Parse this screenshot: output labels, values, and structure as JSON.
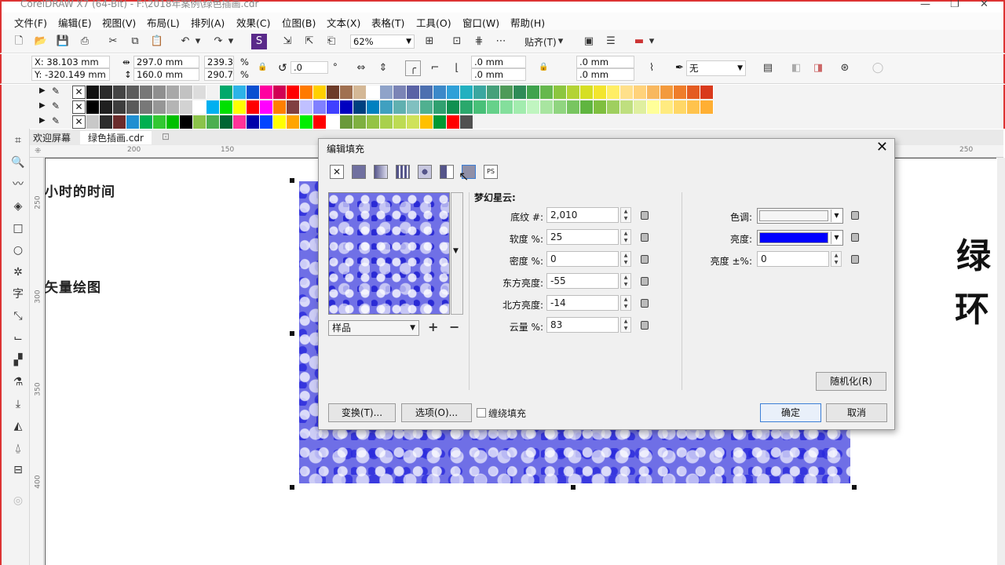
{
  "app": {
    "title": "CorelDRAW X7 (64-Bit) - F:\\2018年案例\\绿色插画.cdr"
  },
  "menu": [
    "文件(F)",
    "编辑(E)",
    "视图(V)",
    "布局(L)",
    "排列(A)",
    "效果(C)",
    "位图(B)",
    "文本(X)",
    "表格(T)",
    "工具(O)",
    "窗口(W)",
    "帮助(H)"
  ],
  "toolbar": {
    "zoom": "62%",
    "snap": "贴齐(T)"
  },
  "property_bar": {
    "x": "X: 38.103 mm",
    "y": "Y: -320.149 mm",
    "width": "297.0 mm",
    "height": "160.0 mm",
    "scale_x": "239.3",
    "scale_y": "290.7",
    "pct": "%",
    "rotation": ".0",
    "degree": "°",
    "corner1": ".0 mm",
    "corner2": ".0 mm",
    "corner3": ".0 mm",
    "corner4": ".0 mm",
    "outline": "无"
  },
  "palette": {
    "row1": [
      "#111111",
      "#2b2b2b",
      "#444444",
      "#5c5c5c",
      "#777777",
      "#8f8f8f",
      "#a8a8a8",
      "#c2c2c2",
      "#dcdcdc",
      "#f2f2f2",
      "#00a86b",
      "#2db3e8",
      "#0a4fd1",
      "#ff00a0",
      "#d10054",
      "#ff0000",
      "#ff7a00",
      "#ffd000",
      "#6d3b28",
      "#a07050",
      "#d4b896",
      "#ffffff",
      "#8fa3c9",
      "#7b84b6",
      "#5a63a5",
      "#4d70b0",
      "#3c89c9",
      "#2fa0d8",
      "#22b0c0",
      "#3aa7a0",
      "#45a07a",
      "#4e9a58",
      "#2e8b57",
      "#3fa34d",
      "#66b84d",
      "#8cc63f",
      "#b3d335",
      "#d6df23",
      "#f3e52e",
      "#ffee66",
      "#ffe08a",
      "#ffd27a",
      "#f8b85f",
      "#f39a3d",
      "#ef7d2a",
      "#e45c21",
      "#d93a1c"
    ],
    "row2": [
      "#000000",
      "#1f1f1f",
      "#3d3d3d",
      "#5a5a5a",
      "#787878",
      "#969696",
      "#b4b4b4",
      "#d2d2d2",
      "#ffffff",
      "#00b0f0",
      "#00e000",
      "#ffff00",
      "#ff0000",
      "#ff00ff",
      "#ff8000",
      "#804040",
      "#c0c0ff",
      "#8080ff",
      "#4040ff",
      "#0000c0",
      "#004080",
      "#0080c0",
      "#40a0c0",
      "#60b0b0",
      "#80c0c0",
      "#50b090",
      "#30a070",
      "#109050",
      "#2aa86c",
      "#48c078",
      "#66d18a",
      "#84df9c",
      "#a2ecae",
      "#c0f5c0",
      "#a8e5a0",
      "#90d580",
      "#78c560",
      "#60b540",
      "#7fbf3f",
      "#9fcf5f",
      "#bfdf7f",
      "#dfef9f",
      "#ffff99",
      "#ffeb80",
      "#ffd766",
      "#ffc34d",
      "#ffaf33"
    ],
    "row3": [
      "#c8c8c8",
      "#2c2c2c",
      "#6b2c2c",
      "#1f8fd1",
      "#00b050",
      "#32c832",
      "#00c000",
      "#000000",
      "#8bc34a",
      "#4caf50",
      "#006633",
      "#ff3399",
      "#0000aa",
      "#0044ff",
      "#ffff00",
      "#ffa500",
      "#00ee00",
      "#ff0000",
      "#ffffff",
      "#6a9a3a",
      "#7fb040",
      "#94c346",
      "#a9d04d",
      "#bddb53",
      "#cfe25a",
      "#ffc000",
      "#009933",
      "#ff0000",
      "#505050"
    ]
  },
  "tabs": {
    "welcome": "欢迎屏幕",
    "doc": "绿色插画.cdr"
  },
  "ruler": {
    "h": [
      "200",
      "150",
      "250"
    ],
    "v": [
      "250",
      "300",
      "350",
      "400"
    ]
  },
  "canvas": {
    "text1": "小时的时间",
    "text2": "矢量绘图",
    "big1": "绿",
    "big2": "环"
  },
  "dialog": {
    "title": "编辑填充",
    "preset": "样品",
    "section": "梦幻星云:",
    "fields": [
      {
        "label": "底纹 #:",
        "value": "2,010"
      },
      {
        "label": "软度 %:",
        "value": "25"
      },
      {
        "label": "密度 %:",
        "value": "0"
      },
      {
        "label": "东方亮度:",
        "value": "-55"
      },
      {
        "label": "北方亮度:",
        "value": "-14"
      },
      {
        "label": "云量 %:",
        "value": "83"
      }
    ],
    "right_fields": [
      {
        "label": "色调:",
        "color": "#f5f5f5"
      },
      {
        "label": "亮度:",
        "color": "#0000ff"
      }
    ],
    "brightness_pm": {
      "label": "亮度 ±%:",
      "value": "0"
    },
    "randomize": "随机化(R)",
    "transform": "变换(T)...",
    "options": "选项(O)...",
    "wrap": "缠绕填充",
    "ok": "确定",
    "cancel": "取消"
  }
}
